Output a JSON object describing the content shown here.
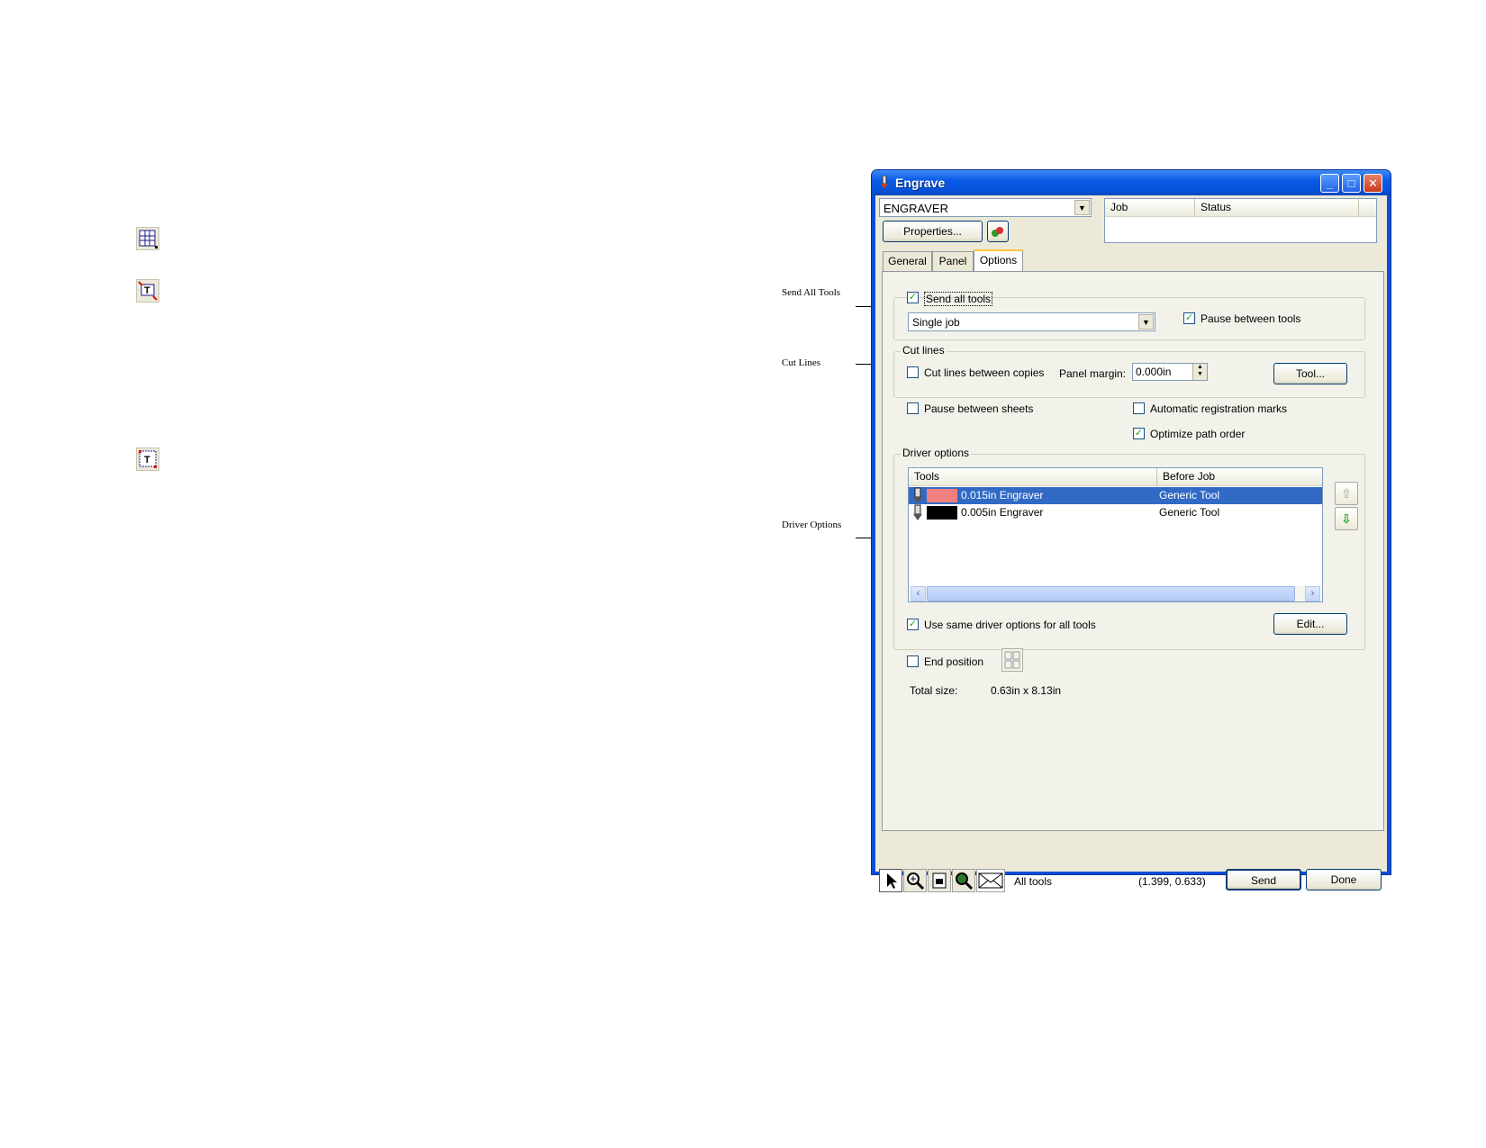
{
  "window": {
    "title": "Engrave"
  },
  "header": {
    "device": "ENGRAVER",
    "properties_label": "Properties...",
    "job_columns": [
      "Job",
      "Status"
    ]
  },
  "tabs": [
    {
      "label": "General",
      "active": false
    },
    {
      "label": "Panel",
      "active": false
    },
    {
      "label": "Options",
      "active": true
    }
  ],
  "send_all": {
    "label": "Send all tools",
    "checked": true,
    "mode": "Single job",
    "pause_label": "Pause between tools",
    "pause_checked": true
  },
  "cut_lines": {
    "group_label": "Cut lines",
    "between_copies_label": "Cut lines between copies",
    "between_copies_checked": false,
    "panel_margin_label": "Panel margin:",
    "panel_margin_value": "0.000in",
    "tool_button": "Tool..."
  },
  "options": {
    "pause_sheets_label": "Pause between sheets",
    "pause_sheets_checked": false,
    "auto_reg_label": "Automatic registration marks",
    "auto_reg_checked": false,
    "optimize_label": "Optimize path order",
    "optimize_checked": true
  },
  "driver": {
    "group_label": "Driver options",
    "columns": [
      "Tools",
      "Before Job"
    ],
    "rows": [
      {
        "color": "#f08080",
        "tool": "0.015in Engraver",
        "before": "Generic Tool",
        "selected": true
      },
      {
        "color": "#000000",
        "tool": "0.005in Engraver",
        "before": "Generic Tool",
        "selected": false
      }
    ],
    "same_label": "Use same driver options for all tools",
    "same_checked": true,
    "edit_button": "Edit..."
  },
  "end_position": {
    "label": "End position",
    "checked": false
  },
  "total": {
    "label": "Total size:",
    "value": "0.63in x  8.13in"
  },
  "footer": {
    "tools_label": "All tools",
    "coords": "(1.399, 0.633)",
    "send": "Send",
    "done": "Done"
  },
  "callouts": {
    "send_all": "Send All Tools",
    "cut_lines": "Cut Lines",
    "driver": "Driver Options"
  },
  "colors": {
    "title_blue": "#0a5ae6",
    "selection": "#316ac5",
    "face": "#ece9d8"
  },
  "icons": [
    "grid-icon",
    "text-crop-icon",
    "text-frame-icon",
    "arrow-icon",
    "zoom-icon",
    "page-icon",
    "magnify-icon",
    "envelope-icon"
  ]
}
